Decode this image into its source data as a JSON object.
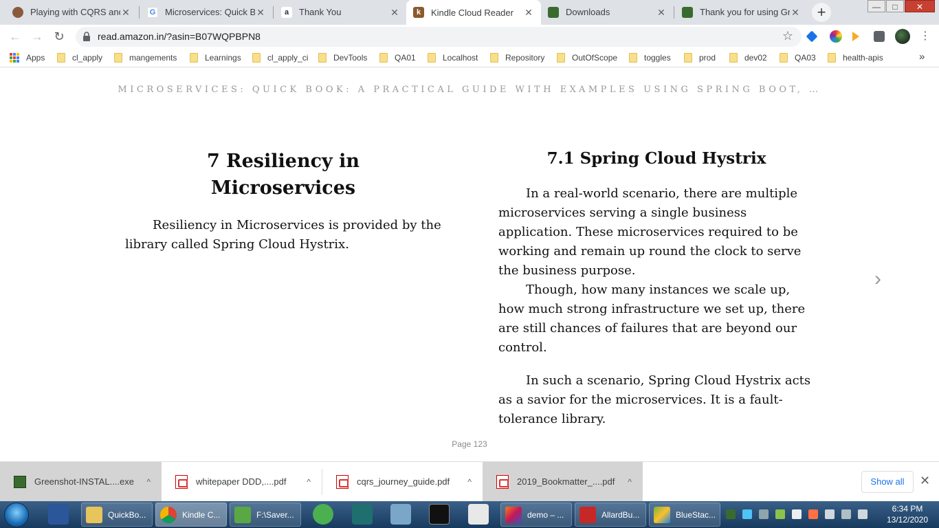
{
  "browser": {
    "tabs": [
      {
        "title": "Playing with CQRS and E",
        "favicon": "avatar-icon",
        "color": "#8b5a3c"
      },
      {
        "title": "Microservices: Quick Boo",
        "favicon": "google-icon",
        "color": "#4285f4"
      },
      {
        "title": "Thank You",
        "favicon": "amazon-icon",
        "color": "#232f3e"
      },
      {
        "title": "Kindle Cloud Reader",
        "favicon": "kindle-icon",
        "color": "#8b5a2b"
      },
      {
        "title": "Downloads",
        "favicon": "greenshot-icon",
        "color": "#3a6b2e"
      },
      {
        "title": "Thank you for using Gre",
        "favicon": "greenshot-icon",
        "color": "#3a6b2e"
      }
    ],
    "active_tab_index": 3,
    "new_tab_label": "+",
    "close_glyph": "✕",
    "url": "read.amazon.in/?asin=B07WQPBPN8",
    "bookmarks": [
      {
        "label": "Apps",
        "type": "apps"
      },
      {
        "label": "cl_apply",
        "type": "folder"
      },
      {
        "label": "mangements",
        "type": "folder"
      },
      {
        "label": "Learnings",
        "type": "folder"
      },
      {
        "label": "cl_apply_ci",
        "type": "folder"
      },
      {
        "label": "DevTools",
        "type": "folder"
      },
      {
        "label": "QA01",
        "type": "folder"
      },
      {
        "label": "Localhost",
        "type": "folder"
      },
      {
        "label": "Repository",
        "type": "folder"
      },
      {
        "label": "OutOfScope",
        "type": "folder"
      },
      {
        "label": "toggles",
        "type": "folder"
      },
      {
        "label": "prod",
        "type": "folder"
      },
      {
        "label": "dev02",
        "type": "folder"
      },
      {
        "label": "QA03",
        "type": "folder"
      },
      {
        "label": "health-apis",
        "type": "folder"
      }
    ],
    "bookmarks_overflow": "»"
  },
  "reader": {
    "book_title": "MICROSERVICES: QUICK BOOK: A PRACTICAL GUIDE WITH EXAMPLES USING SPRING BOOT, …",
    "left": {
      "heading_line1": "7 Resiliency in",
      "heading_line2": "Microservices",
      "paragraph": "Resiliency in Microservices is provided by the library called Spring Cloud Hystrix."
    },
    "right": {
      "heading": "7.1 Spring Cloud Hystrix",
      "paragraph1": "In a real-world scenario, there are multiple microservices serving a single business application. These microservices required to be working and remain up round the clock to serve the business purpose.",
      "paragraph2": "Though, how many instances we scale up, how much strong infrastructure we set up, there are still chances of failures that are beyond our control.",
      "paragraph3": "In such a scenario, Spring Cloud Hystrix acts as a savior for the microservices. It is a fault-tolerance library."
    },
    "page_label": "Page 123",
    "next_glyph": "›"
  },
  "downloads": {
    "items": [
      {
        "name": "Greenshot-INSTAL....exe",
        "type": "exe"
      },
      {
        "name": "whitepaper DDD,....pdf",
        "type": "pdf"
      },
      {
        "name": "cqrs_journey_guide.pdf",
        "type": "pdf"
      },
      {
        "name": "2019_Bookmatter_....pdf",
        "type": "pdf"
      }
    ],
    "chevron": "^",
    "show_all": "Show all",
    "close_glyph": "✕"
  },
  "taskbar": {
    "buttons": [
      {
        "label": "QuickBo...",
        "icon": "folder-icon",
        "color": "#e8c45c"
      },
      {
        "label": "Kindle C...",
        "icon": "chrome-icon",
        "color": "#db4437"
      },
      {
        "label": "F:\\Saver...",
        "icon": "editor-icon",
        "color": "#5aa845"
      },
      {
        "label": "demo – ...",
        "icon": "intellij-icon",
        "color": "#c2185b"
      },
      {
        "label": "AllardBu...",
        "icon": "acrobat-icon",
        "color": "#c62828"
      },
      {
        "label": "BlueStac...",
        "icon": "bluestacks-icon",
        "color": "#7cb342"
      }
    ],
    "time": "6:34 PM",
    "date": "13/12/2020"
  },
  "colors": {
    "tab_strip": "#dee1e6",
    "link_blue": "#1a73e8",
    "taskbar": "#1d3f66"
  }
}
